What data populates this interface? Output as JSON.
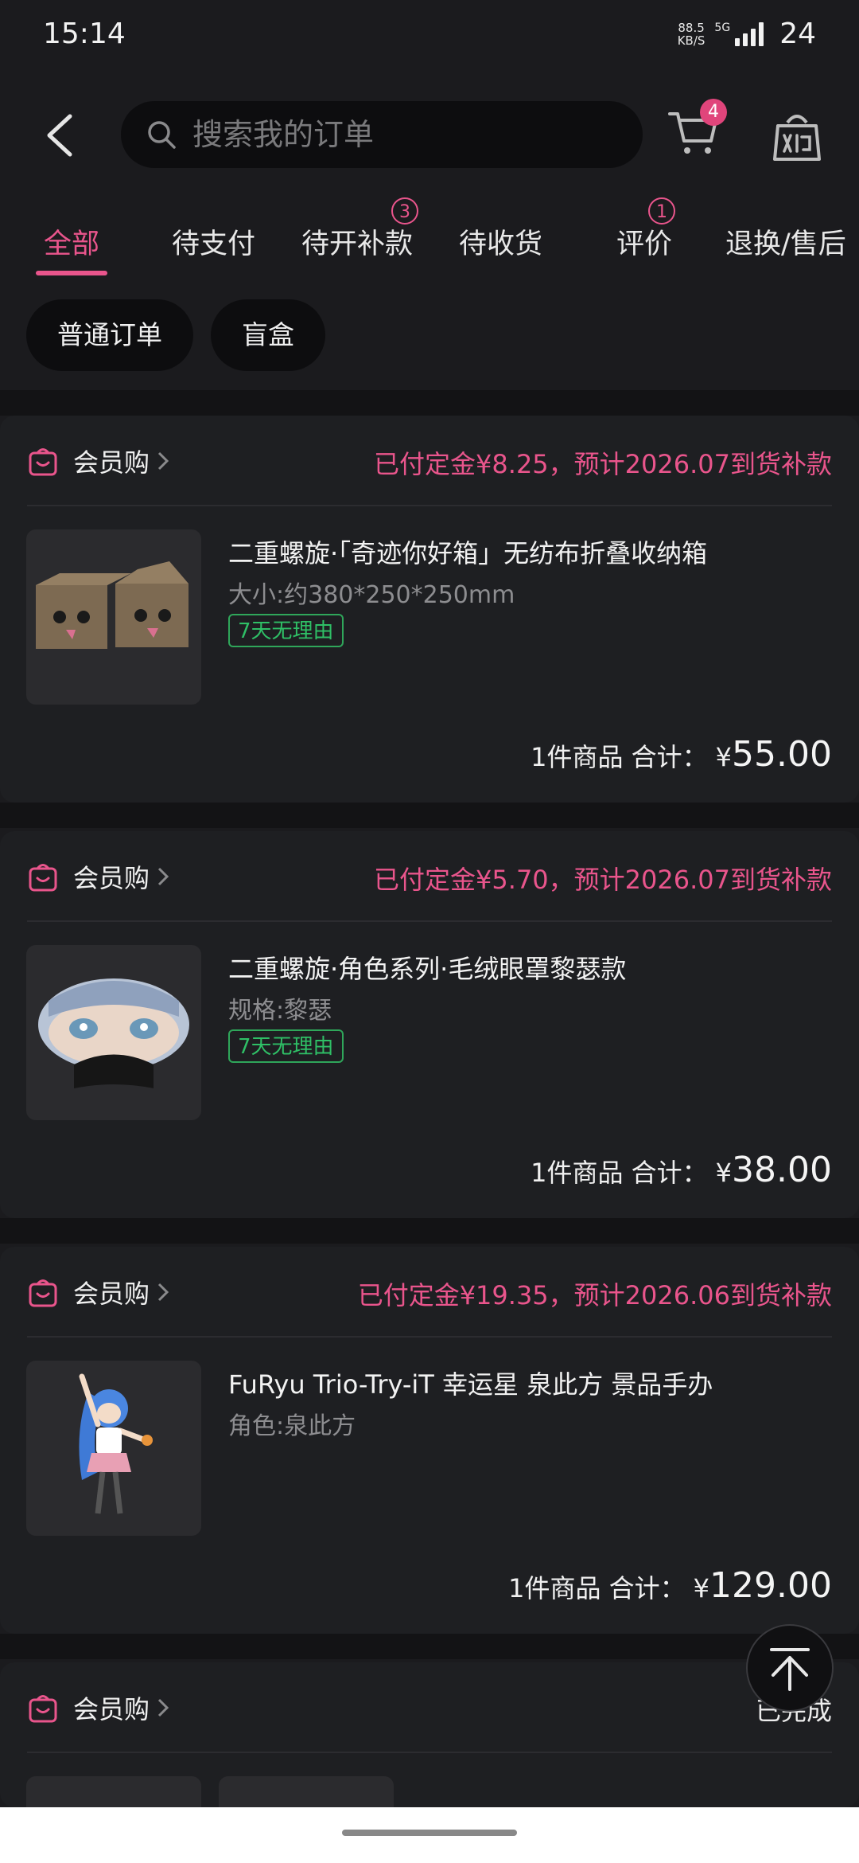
{
  "status_bar": {
    "time": "15:14",
    "net_speed_value": "88.5",
    "net_speed_unit": "KB/S",
    "network": "5G",
    "battery": "24"
  },
  "header": {
    "search_placeholder": "搜索我的订单",
    "cart_badge": "4"
  },
  "tabs": [
    {
      "label": "全部",
      "active": true,
      "badge": ""
    },
    {
      "label": "待支付",
      "active": false,
      "badge": ""
    },
    {
      "label": "待开补款",
      "active": false,
      "badge": "3"
    },
    {
      "label": "待收货",
      "active": false,
      "badge": ""
    },
    {
      "label": "评价",
      "active": false,
      "badge": "1"
    },
    {
      "label": "退换/售后",
      "active": false,
      "badge": ""
    }
  ],
  "filters": [
    "普通订单",
    "盲盒"
  ],
  "orders": [
    {
      "store": "会员购",
      "status": "已付定金¥8.25，预计2026.07到货补款",
      "title": "二重螺旋·「奇迹你好箱」无纺布折叠收纳箱",
      "spec": "大小:约380*250*250mm",
      "tag": "7天无理由",
      "count_label": "1件商品 合计：",
      "currency": "¥",
      "amount": "55.00",
      "thumb": "box-icon"
    },
    {
      "store": "会员购",
      "status": "已付定金¥5.70，预计2026.07到货补款",
      "title": "二重螺旋·角色系列·毛绒眼罩黎瑟款",
      "spec": "规格:黎瑟",
      "tag": "7天无理由",
      "count_label": "1件商品 合计：",
      "currency": "¥",
      "amount": "38.00",
      "thumb": "eye-mask-icon"
    },
    {
      "store": "会员购",
      "status": "已付定金¥19.35，预计2026.06到货补款",
      "title": "FuRyu Trio-Try-iT 幸运星 泉此方 景品手办",
      "spec": "角色:泉此方",
      "tag": "",
      "count_label": "1件商品 合计：",
      "currency": "¥",
      "amount": "129.00",
      "thumb": "figure-icon"
    },
    {
      "store": "会员购",
      "status": "已完成"
    }
  ],
  "colors": {
    "accent": "#e9558c",
    "tag_green": "#2fbf66",
    "background": "#1b1b1e"
  }
}
